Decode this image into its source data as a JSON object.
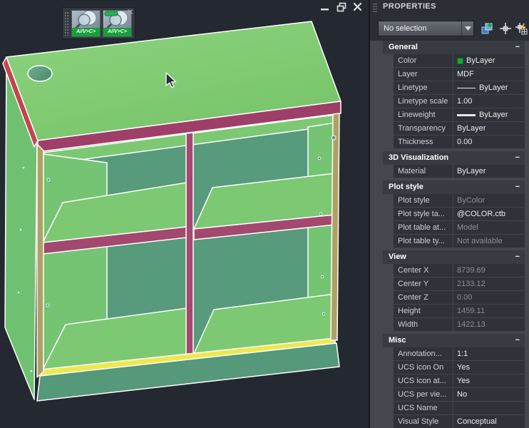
{
  "colors": {
    "canvas_bg": "#242830",
    "top_green": "#82cb74",
    "shelf_green": "#7cc873",
    "interior_green": "#74c474",
    "exterior_green": "#6fc171",
    "back_teal": "#589a7c",
    "plinth_teal": "#55987a",
    "edge_magenta": "#a3486f",
    "edge_red": "#c2454e",
    "edge_tan": "#aea164",
    "edge_yellow": "#ece94f",
    "edge_outline": "#ffffff",
    "panel_bg": "#45474c",
    "row_bg": "#2f3238",
    "header_bg": "#383b42",
    "color_swatch": "#1ca53a"
  },
  "floating_toolbar": {
    "buttons": [
      {
        "name": "zoom-tool-1",
        "label": "A//V>C>"
      },
      {
        "name": "zoom-tool-2",
        "label": "A//V>C>"
      }
    ]
  },
  "properties_panel": {
    "title": "PROPERTIES",
    "selection_dropdown": {
      "value": "No selection"
    },
    "toolbar_icons": [
      "toggle-pickadd-icon",
      "select-objects-icon",
      "quick-select-icon"
    ],
    "collapse_glyph": "−",
    "sections": [
      {
        "title": "General",
        "rows": [
          {
            "label": "Color",
            "value": "ByLayer",
            "swatch": "#1ca53a"
          },
          {
            "label": "Layer",
            "value": "MDF"
          },
          {
            "label": "Linetype",
            "value": "ByLayer",
            "glyph": "thin-line"
          },
          {
            "label": "Linetype scale",
            "value": "1.00"
          },
          {
            "label": "Lineweight",
            "value": "ByLayer",
            "glyph": "thick-line"
          },
          {
            "label": "Transparency",
            "value": "ByLayer"
          },
          {
            "label": "Thickness",
            "value": "0.00"
          }
        ]
      },
      {
        "title": "3D Visualization",
        "rows": [
          {
            "label": "Material",
            "value": "ByLayer"
          }
        ]
      },
      {
        "title": "Plot style",
        "rows": [
          {
            "label": "Plot style",
            "value": "ByColor",
            "readonly": true
          },
          {
            "label": "Plot style ta...",
            "value": "@COLOR.ctb"
          },
          {
            "label": "Plot table at...",
            "value": "Model",
            "readonly": true
          },
          {
            "label": "Plot table ty...",
            "value": "Not available",
            "readonly": true
          }
        ]
      },
      {
        "title": "View",
        "rows": [
          {
            "label": "Center X",
            "value": "8739.69",
            "readonly": true
          },
          {
            "label": "Center Y",
            "value": "2133.12",
            "readonly": true
          },
          {
            "label": "Center Z",
            "value": "0.00",
            "readonly": true
          },
          {
            "label": "Height",
            "value": "1459.11",
            "readonly": true
          },
          {
            "label": "Width",
            "value": "1422.13",
            "readonly": true
          }
        ]
      },
      {
        "title": "Misc",
        "rows": [
          {
            "label": "Annotation...",
            "value": "1:1"
          },
          {
            "label": "UCS icon On",
            "value": "Yes"
          },
          {
            "label": "UCS icon at...",
            "value": "Yes"
          },
          {
            "label": "UCS per vie...",
            "value": "No"
          },
          {
            "label": "UCS Name",
            "value": ""
          },
          {
            "label": "Visual Style",
            "value": "Conceptual"
          }
        ]
      }
    ]
  }
}
